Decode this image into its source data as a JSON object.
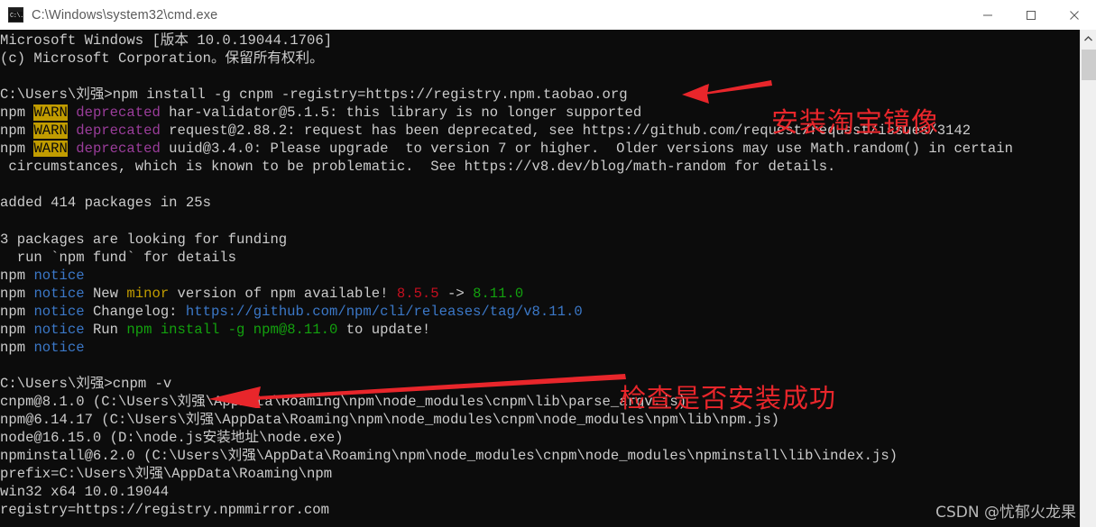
{
  "window": {
    "title": "C:\\Windows\\system32\\cmd.exe",
    "icon": "cmd-icon",
    "controls": {
      "minimize": "minimize-icon",
      "maximize": "maximize-icon",
      "close": "close-icon"
    }
  },
  "colors": {
    "console_bg": "#0c0c0c",
    "console_fg": "#cccccc",
    "warn_badge_bg": "#c19c00",
    "magenta": "#9b3d9b",
    "blue": "#3b78c8",
    "yellow": "#c19c00",
    "red": "#c50f1f",
    "green": "#13a10e",
    "annotation_red": "#e8262b"
  },
  "console": {
    "lines": [
      {
        "id": "l1",
        "segments": [
          {
            "t": "Microsoft Windows [版本 10.0.19044.1706]",
            "c": "c-white"
          }
        ]
      },
      {
        "id": "l2",
        "segments": [
          {
            "t": "(c) Microsoft Corporation。保留所有权利。",
            "c": "c-white"
          }
        ]
      },
      {
        "id": "l3",
        "segments": [
          {
            "t": "",
            "c": "c-white"
          }
        ]
      },
      {
        "id": "l4",
        "segments": [
          {
            "t": "C:\\Users\\刘强>npm install -g cnpm -registry=https://registry.npm.taobao.org",
            "c": "c-white"
          }
        ]
      },
      {
        "id": "l5",
        "segments": [
          {
            "t": "npm ",
            "c": "c-white"
          },
          {
            "t": "WARN",
            "c": "c-warnbg"
          },
          {
            "t": " ",
            "c": "c-white"
          },
          {
            "t": "deprecated",
            "c": "c-magenta"
          },
          {
            "t": " har-validator@5.1.5: this library is no longer supported",
            "c": "c-white"
          }
        ]
      },
      {
        "id": "l6",
        "segments": [
          {
            "t": "npm ",
            "c": "c-white"
          },
          {
            "t": "WARN",
            "c": "c-warnbg"
          },
          {
            "t": " ",
            "c": "c-white"
          },
          {
            "t": "deprecated",
            "c": "c-magenta"
          },
          {
            "t": " request@2.88.2: request has been deprecated, see https://github.com/request/request/issues/3142",
            "c": "c-white"
          }
        ]
      },
      {
        "id": "l7",
        "segments": [
          {
            "t": "npm ",
            "c": "c-white"
          },
          {
            "t": "WARN",
            "c": "c-warnbg"
          },
          {
            "t": " ",
            "c": "c-white"
          },
          {
            "t": "deprecated",
            "c": "c-magenta"
          },
          {
            "t": " uuid@3.4.0: Please upgrade  to version 7 or higher.  Older versions may use Math.random() in certain",
            "c": "c-white"
          }
        ]
      },
      {
        "id": "l8",
        "segments": [
          {
            "t": " circumstances, which is known to be problematic.  See https://v8.dev/blog/math-random for details.",
            "c": "c-white"
          }
        ]
      },
      {
        "id": "l9",
        "segments": [
          {
            "t": "",
            "c": "c-white"
          }
        ]
      },
      {
        "id": "l10",
        "segments": [
          {
            "t": "added 414 packages in 25s",
            "c": "c-white"
          }
        ]
      },
      {
        "id": "l11",
        "segments": [
          {
            "t": "",
            "c": "c-white"
          }
        ]
      },
      {
        "id": "l12",
        "segments": [
          {
            "t": "3 packages are looking for funding",
            "c": "c-white"
          }
        ]
      },
      {
        "id": "l13",
        "segments": [
          {
            "t": "  run `npm fund` for details",
            "c": "c-white"
          }
        ]
      },
      {
        "id": "l14",
        "segments": [
          {
            "t": "npm ",
            "c": "c-white"
          },
          {
            "t": "notice",
            "c": "c-cyan"
          }
        ]
      },
      {
        "id": "l15",
        "segments": [
          {
            "t": "npm ",
            "c": "c-white"
          },
          {
            "t": "notice",
            "c": "c-cyan"
          },
          {
            "t": " New ",
            "c": "c-white"
          },
          {
            "t": "minor",
            "c": "c-yellow"
          },
          {
            "t": " version of npm available! ",
            "c": "c-white"
          },
          {
            "t": "8.5.5",
            "c": "c-red"
          },
          {
            "t": " -> ",
            "c": "c-white"
          },
          {
            "t": "8.11.0",
            "c": "c-green"
          }
        ]
      },
      {
        "id": "l16",
        "segments": [
          {
            "t": "npm ",
            "c": "c-white"
          },
          {
            "t": "notice",
            "c": "c-cyan"
          },
          {
            "t": " Changelog: ",
            "c": "c-white"
          },
          {
            "t": "https://github.com/npm/cli/releases/tag/v8.11.0",
            "c": "c-blue"
          }
        ]
      },
      {
        "id": "l17",
        "segments": [
          {
            "t": "npm ",
            "c": "c-white"
          },
          {
            "t": "notice",
            "c": "c-cyan"
          },
          {
            "t": " Run ",
            "c": "c-white"
          },
          {
            "t": "npm install -g npm@8.11.0",
            "c": "c-green"
          },
          {
            "t": " to update!",
            "c": "c-white"
          }
        ]
      },
      {
        "id": "l18",
        "segments": [
          {
            "t": "npm ",
            "c": "c-white"
          },
          {
            "t": "notice",
            "c": "c-cyan"
          }
        ]
      },
      {
        "id": "l19",
        "segments": [
          {
            "t": "",
            "c": "c-white"
          }
        ]
      },
      {
        "id": "l20",
        "segments": [
          {
            "t": "C:\\Users\\刘强>cnpm -v",
            "c": "c-white"
          }
        ]
      },
      {
        "id": "l21",
        "segments": [
          {
            "t": "cnpm@8.1.0 (C:\\Users\\刘强\\AppData\\Roaming\\npm\\node_modules\\cnpm\\lib\\parse_argv.js)",
            "c": "c-white"
          }
        ]
      },
      {
        "id": "l22",
        "segments": [
          {
            "t": "npm@6.14.17 (C:\\Users\\刘强\\AppData\\Roaming\\npm\\node_modules\\cnpm\\node_modules\\npm\\lib\\npm.js)",
            "c": "c-white"
          }
        ]
      },
      {
        "id": "l23",
        "segments": [
          {
            "t": "node@16.15.0 (D:\\node.js安装地址\\node.exe)",
            "c": "c-white"
          }
        ]
      },
      {
        "id": "l24",
        "segments": [
          {
            "t": "npminstall@6.2.0 (C:\\Users\\刘强\\AppData\\Roaming\\npm\\node_modules\\cnpm\\node_modules\\npminstall\\lib\\index.js)",
            "c": "c-white"
          }
        ]
      },
      {
        "id": "l25",
        "segments": [
          {
            "t": "prefix=C:\\Users\\刘强\\AppData\\Roaming\\npm",
            "c": "c-white"
          }
        ]
      },
      {
        "id": "l26",
        "segments": [
          {
            "t": "win32 x64 10.0.19044",
            "c": "c-white"
          }
        ]
      },
      {
        "id": "l27",
        "segments": [
          {
            "t": "registry=https://registry.npmmirror.com",
            "c": "c-white"
          }
        ]
      }
    ]
  },
  "annotations": {
    "install_mirror": "安装淘宝镜像",
    "check_success": "检查是否安装成功"
  },
  "watermark": "CSDN @忧郁火龙果",
  "scrollbar": {
    "up_arrow": "chevron-up-icon"
  }
}
